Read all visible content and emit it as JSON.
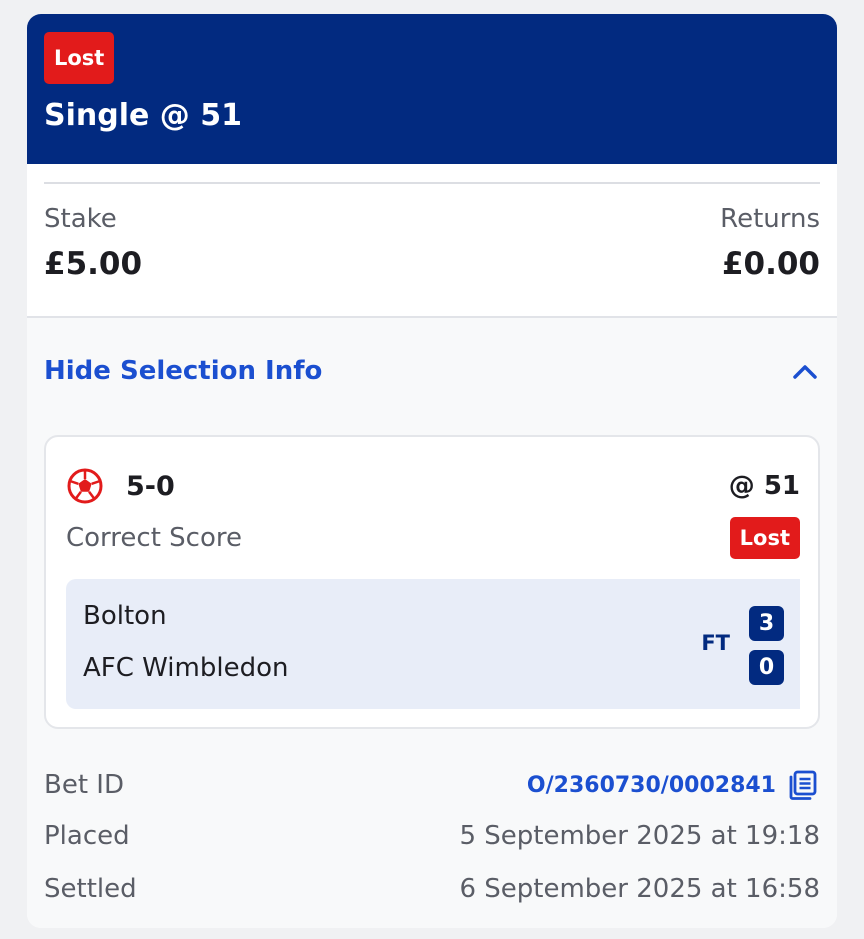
{
  "header": {
    "status_badge": "Lost",
    "title": "Single @ 51"
  },
  "stake": {
    "stake_label": "Stake",
    "stake_value": "£5.00",
    "returns_label": "Returns",
    "returns_value": "£0.00"
  },
  "selection_toggle": {
    "label": "Hide Selection Info",
    "icon": "chevron-up-icon"
  },
  "selection": {
    "icon": "football-icon",
    "name": "5-0",
    "odds": "@ 51",
    "market": "Correct Score",
    "status_badge": "Lost",
    "event": {
      "home_team": "Bolton",
      "away_team": "AFC Wimbledon",
      "status": "FT",
      "home_score": "3",
      "away_score": "0"
    }
  },
  "details": {
    "bet_id_label": "Bet ID",
    "bet_id_value": "O/2360730/0002841",
    "copy_icon": "copy-icon",
    "placed_label": "Placed",
    "placed_value": "5 September 2025 at 19:18",
    "settled_label": "Settled",
    "settled_value": "6 September 2025 at 16:58"
  },
  "colors": {
    "header_bg": "#022a80",
    "lost_red": "#e21b1b",
    "link_blue": "#1b4fd0",
    "score_panel_bg": "#e8edf8"
  }
}
